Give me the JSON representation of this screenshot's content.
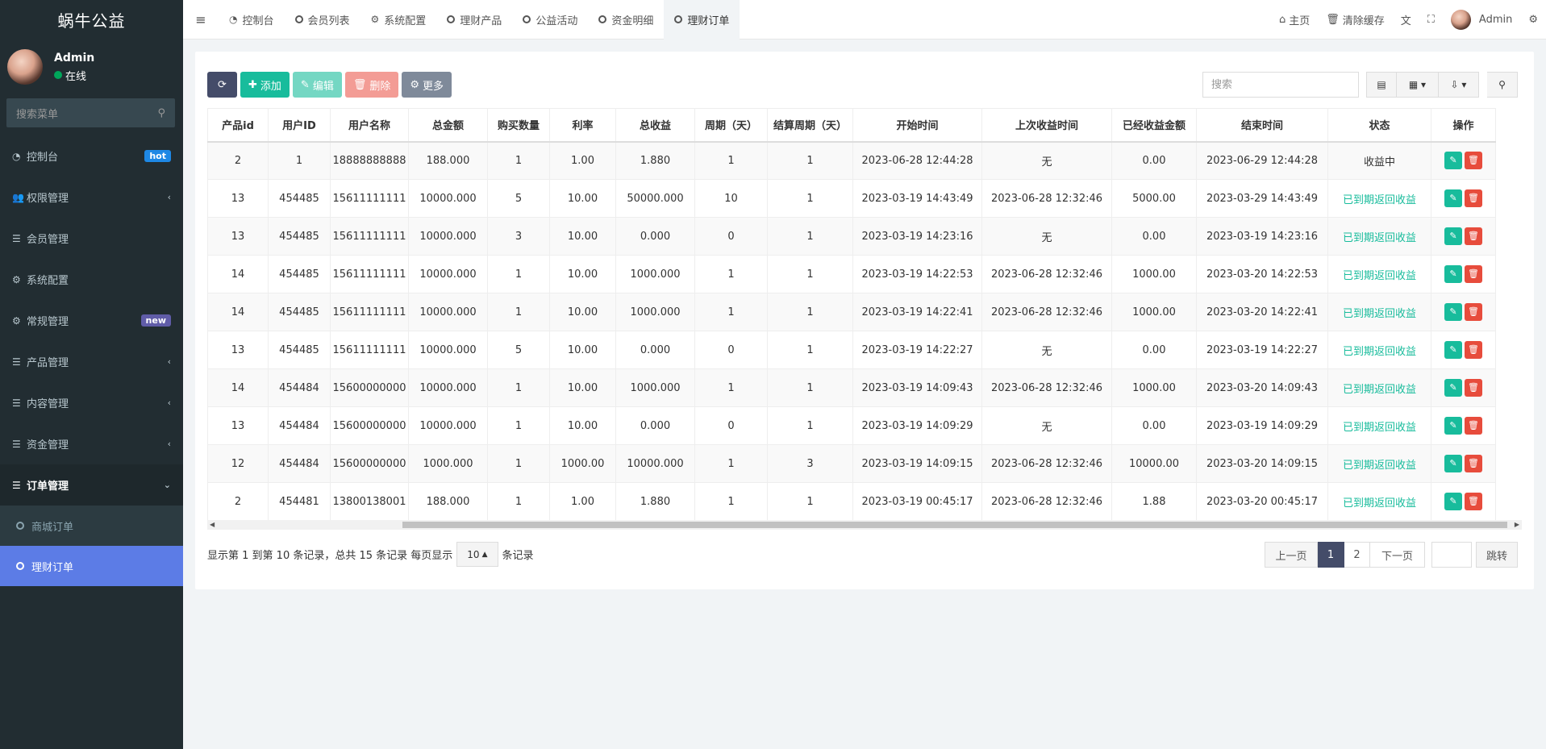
{
  "app": {
    "title": "蜗牛公益"
  },
  "user": {
    "name": "Admin",
    "status": "在线"
  },
  "sidebar": {
    "search_placeholder": "搜索菜单",
    "items": [
      {
        "label": "控制台",
        "icon": "dashboard-icon",
        "glyph": "◔",
        "badge": "hot",
        "chevron": ""
      },
      {
        "label": "权限管理",
        "icon": "users-icon",
        "glyph": "👥",
        "badge": "",
        "chevron": "‹"
      },
      {
        "label": "会员管理",
        "icon": "list-icon",
        "glyph": "☰",
        "badge": "",
        "chevron": ""
      },
      {
        "label": "系统配置",
        "icon": "gear-icon",
        "glyph": "⚙",
        "badge": "",
        "chevron": ""
      },
      {
        "label": "常规管理",
        "icon": "cogs-icon",
        "glyph": "⚙",
        "badge": "new",
        "chevron": ""
      },
      {
        "label": "产品管理",
        "icon": "list-icon",
        "glyph": "☰",
        "badge": "",
        "chevron": "‹"
      },
      {
        "label": "内容管理",
        "icon": "list-icon",
        "glyph": "☰",
        "badge": "",
        "chevron": "‹"
      },
      {
        "label": "资金管理",
        "icon": "list-icon",
        "glyph": "☰",
        "badge": "",
        "chevron": "‹"
      }
    ],
    "active_parent": {
      "label": "订单管理",
      "chevron": "⌄"
    },
    "sub_items": [
      {
        "label": "商城订单"
      },
      {
        "label": "理财订单"
      }
    ]
  },
  "header": {
    "tabs": [
      {
        "label": "控制台",
        "icon": "dashboard-icon"
      },
      {
        "label": "会员列表",
        "icon": "circle-icon"
      },
      {
        "label": "系统配置",
        "icon": "gear-icon"
      },
      {
        "label": "理财产品",
        "icon": "circle-icon"
      },
      {
        "label": "公益活动",
        "icon": "circle-icon"
      },
      {
        "label": "资金明细",
        "icon": "circle-icon"
      },
      {
        "label": "理财订单",
        "icon": "circle-icon"
      }
    ],
    "home": "主页",
    "clear_cache": "清除缓存",
    "admin": "Admin"
  },
  "toolbar": {
    "add": "添加",
    "edit": "编辑",
    "delete": "删除",
    "more": "更多",
    "search_placeholder": "搜索"
  },
  "table": {
    "columns": [
      "产品id",
      "用户ID",
      "用户名称",
      "总金额",
      "购买数量",
      "利率",
      "总收益",
      "周期（天）",
      "结算周期（天）",
      "开始时间",
      "上次收益时间",
      "已经收益金额",
      "结束时间",
      "状态",
      "操作"
    ],
    "rows": [
      [
        "2",
        "1",
        "18888888888",
        "188.000",
        "1",
        "1.00",
        "1.880",
        "1",
        "1",
        "2023-06-28 12:44:28",
        "无",
        "0.00",
        "2023-06-29 12:44:28",
        "收益中"
      ],
      [
        "13",
        "454485",
        "15611111111",
        "10000.000",
        "5",
        "10.00",
        "50000.000",
        "10",
        "1",
        "2023-03-19 14:43:49",
        "2023-06-28 12:32:46",
        "5000.00",
        "2023-03-29 14:43:49",
        "已到期返回收益"
      ],
      [
        "13",
        "454485",
        "15611111111",
        "10000.000",
        "3",
        "10.00",
        "0.000",
        "0",
        "1",
        "2023-03-19 14:23:16",
        "无",
        "0.00",
        "2023-03-19 14:23:16",
        "已到期返回收益"
      ],
      [
        "14",
        "454485",
        "15611111111",
        "10000.000",
        "1",
        "10.00",
        "1000.000",
        "1",
        "1",
        "2023-03-19 14:22:53",
        "2023-06-28 12:32:46",
        "1000.00",
        "2023-03-20 14:22:53",
        "已到期返回收益"
      ],
      [
        "14",
        "454485",
        "15611111111",
        "10000.000",
        "1",
        "10.00",
        "1000.000",
        "1",
        "1",
        "2023-03-19 14:22:41",
        "2023-06-28 12:32:46",
        "1000.00",
        "2023-03-20 14:22:41",
        "已到期返回收益"
      ],
      [
        "13",
        "454485",
        "15611111111",
        "10000.000",
        "5",
        "10.00",
        "0.000",
        "0",
        "1",
        "2023-03-19 14:22:27",
        "无",
        "0.00",
        "2023-03-19 14:22:27",
        "已到期返回收益"
      ],
      [
        "14",
        "454484",
        "15600000000",
        "10000.000",
        "1",
        "10.00",
        "1000.000",
        "1",
        "1",
        "2023-03-19 14:09:43",
        "2023-06-28 12:32:46",
        "1000.00",
        "2023-03-20 14:09:43",
        "已到期返回收益"
      ],
      [
        "13",
        "454484",
        "15600000000",
        "10000.000",
        "1",
        "10.00",
        "0.000",
        "0",
        "1",
        "2023-03-19 14:09:29",
        "无",
        "0.00",
        "2023-03-19 14:09:29",
        "已到期返回收益"
      ],
      [
        "12",
        "454484",
        "15600000000",
        "1000.000",
        "1",
        "1000.00",
        "10000.000",
        "1",
        "3",
        "2023-03-19 14:09:15",
        "2023-06-28 12:32:46",
        "10000.00",
        "2023-03-20 14:09:15",
        "已到期返回收益"
      ],
      [
        "2",
        "454481",
        "13800138001",
        "188.000",
        "1",
        "1.00",
        "1.880",
        "1",
        "1",
        "2023-03-19 00:45:17",
        "2023-06-28 12:32:46",
        "1.88",
        "2023-03-20 00:45:17",
        "已到期返回收益"
      ]
    ]
  },
  "footer": {
    "info_prefix": "显示第 1 到第 10 条记录，总共 15 条记录 每页显示",
    "page_size": "10",
    "info_suffix": "条记录"
  },
  "pager": {
    "prev": "上一页",
    "current": "1",
    "page2": "2",
    "next": "下一页",
    "jump": "跳转"
  },
  "colors": {
    "sidebar_bg": "#222d32",
    "active_menu": "#5c7ce6",
    "success": "#18bc9c",
    "danger": "#e74c3c"
  }
}
